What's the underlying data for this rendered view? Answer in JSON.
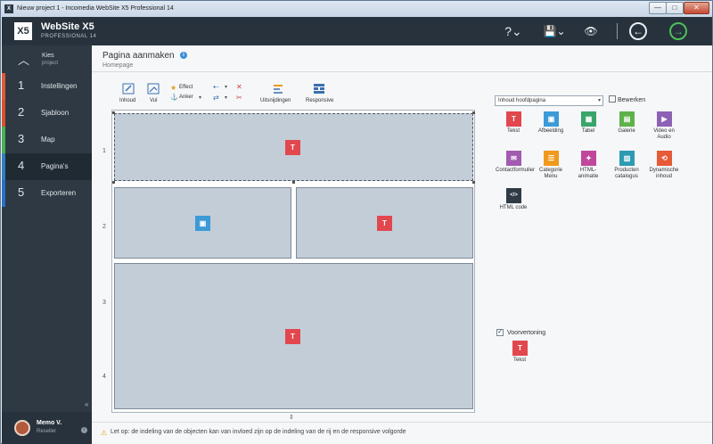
{
  "window": {
    "title": "Nieuw project 1 - Incomedia WebSite X5 Professional 14",
    "min": "—",
    "max": "□",
    "close": "✕"
  },
  "header": {
    "brand": "WebSite X5",
    "brand_sub": "PROFESSIONAL 14",
    "logo": "X5",
    "icons": {
      "help": "?⌄",
      "save": "💾⌄",
      "preview": "👁",
      "back": "←",
      "forward": "→"
    }
  },
  "sidebar": {
    "home": {
      "label": "Kies",
      "sublabel": "project"
    },
    "items": [
      {
        "num": "1",
        "label": "Instellingen",
        "color": "#e05a3a"
      },
      {
        "num": "2",
        "label": "Sjabloon",
        "color": "#d8532b"
      },
      {
        "num": "3",
        "label": "Map",
        "color": "#4caf50"
      },
      {
        "num": "4",
        "label": "Pagina's",
        "color": "#2e7fbe"
      },
      {
        "num": "5",
        "label": "Exporteren",
        "color": "#2b6fc9"
      }
    ],
    "collapse": "«",
    "user": {
      "name": "Memo V.",
      "role": "Reseller",
      "info": "i"
    }
  },
  "page": {
    "title": "Pagina aanmaken",
    "subtitle": "Homepage",
    "info": "i"
  },
  "toolbar": {
    "inhoud": "Inhoud",
    "vul": "Vul",
    "effect": "Effect",
    "anker": "Anker",
    "uitsnijding": "Uitsnijdingen",
    "responsive": "Responsive"
  },
  "grid": {
    "rows": [
      "1",
      "2",
      "3",
      "4"
    ],
    "add_row": "⇕"
  },
  "footer": {
    "text": "Let op: de indeling van de objecten kan van invloed zijn op de indeling van de rij en de responsive volgorde"
  },
  "objects_panel": {
    "dropdown_value": "Inhoud hoofdpagina",
    "edit_label": "Bewerken",
    "objects": [
      {
        "label": "Tekst",
        "color": "#e2474e",
        "glyph": "T"
      },
      {
        "label": "Afbeelding",
        "color": "#3c9ad6",
        "glyph": "▣"
      },
      {
        "label": "Tabel",
        "color": "#3aa56a",
        "glyph": "▦"
      },
      {
        "label": "Galerie",
        "color": "#5fb24a",
        "glyph": "▤"
      },
      {
        "label": "Video en Audio",
        "color": "#8d62b5",
        "glyph": "▶"
      },
      {
        "label": "Contactformulier",
        "color": "#a25bb0",
        "glyph": "✉"
      },
      {
        "label": "Categorie Menu",
        "color": "#f09a1d",
        "glyph": "☰"
      },
      {
        "label": "HTML-animatie",
        "color": "#c0479b",
        "glyph": "✦"
      },
      {
        "label": "Producten catalogus",
        "color": "#2d9bb2",
        "glyph": "▥"
      },
      {
        "label": "Dynamische inhoud",
        "color": "#e65a37",
        "glyph": "⟲"
      },
      {
        "label": "HTML code",
        "color": "#2f3a45",
        "glyph": "</>"
      }
    ],
    "preview_check": "✓",
    "preview_label": "Voorvertoning",
    "preview_object": {
      "label": "Tekst",
      "color": "#e2474e",
      "glyph": "T"
    }
  }
}
